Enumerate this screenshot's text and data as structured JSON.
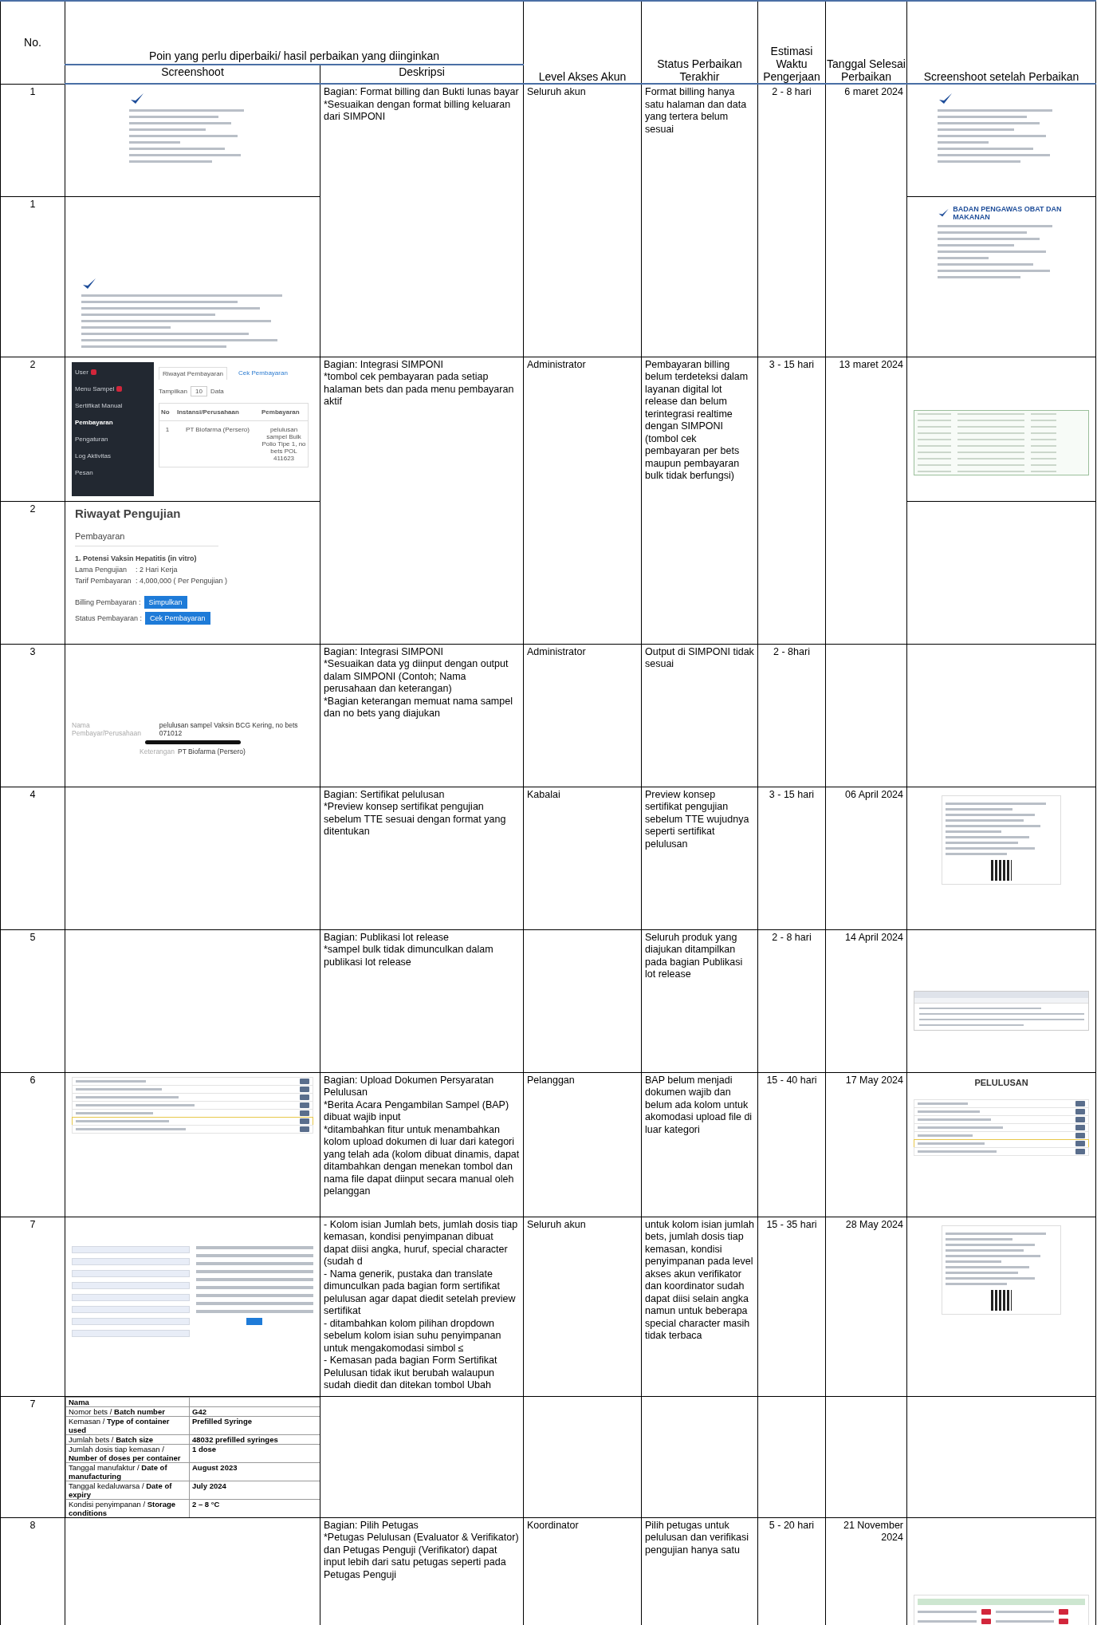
{
  "header": {
    "no": "No.",
    "group": "Poin yang perlu diperbaiki/ hasil perbaikan yang diinginkan",
    "screenshot": "Screenshoot",
    "description": "Deskripsi",
    "level": "Level Akses Akun",
    "status": "Status Perbaikan Terakhir",
    "estimate": "Estimasi Waktu Pengerjaan",
    "date": "Tanggal Selesai Perbaikan",
    "after": "Screenshoot setelah Perbaikan"
  },
  "items": [
    {
      "description": "Bagian: Format billing dan Bukti lunas bayar\n*Sesuaikan dengan format billing keluaran dari SIMPONI",
      "level": "Seluruh akun",
      "status": "Format billing hanya satu halaman dan data yang tertera belum sesuai",
      "estimate": "2 - 8 hari",
      "date": "6 maret 2024",
      "parts": [
        {
          "no": "1",
          "screenshot": {
            "kind": "doc"
          },
          "after": {
            "kind": "doc"
          }
        },
        {
          "no": "1",
          "screenshot": {
            "kind": "doc-wide"
          },
          "after": {
            "kind": "doc",
            "title": "BADAN PENGAWAS OBAT DAN MAKANAN"
          }
        }
      ]
    },
    {
      "description": "Bagian: Integrasi SIMPONI\n*tombol cek pembayaran pada setiap halaman bets dan pada menu pembayaran aktif",
      "level": "Administrator",
      "status": "Pembayaran billing belum terdeteksi dalam layanan digital lot release dan belum terintegrasi realtime dengan SIMPONI (tombol cek pembayaran per bets maupun pembayaran bulk tidak berfungsi)",
      "estimate": "3 - 15 hari",
      "date": "13 maret 2024",
      "parts": [
        {
          "no": "2",
          "screenshot": {
            "kind": "admin",
            "menu": [
              {
                "label": "User",
                "badge": true,
                "selected": false
              },
              {
                "label": "Menu Sampel",
                "badge": true,
                "selected": false
              },
              {
                "label": "Sertifikat Manual",
                "badge": false,
                "selected": false
              },
              {
                "label": "Pembayaran",
                "badge": false,
                "selected": true
              },
              {
                "label": "Pengaturan",
                "badge": false,
                "selected": false
              },
              {
                "label": "Log Aktivitas",
                "badge": false,
                "selected": false
              },
              {
                "label": "Pesan",
                "badge": false,
                "selected": false
              }
            ],
            "tabs": [
              {
                "label": "Riwayat Pembayaran",
                "selected": true
              },
              {
                "label": "Cek Pembayaran",
                "selected": false
              }
            ],
            "show_label": "Tampilkan",
            "show_value": "10",
            "show_unit": "Data",
            "columns": [
              "No",
              "Instansi/Perusahaan",
              "Pembayaran"
            ],
            "row": [
              "1",
              "PT Biofarma (Persero)",
              "pelulusan sampel Bulk Polio Tipe 1, no bets POL 411623"
            ]
          },
          "after": {
            "kind": "sheet"
          }
        },
        {
          "no": "2",
          "screenshot": {
            "kind": "detail",
            "title": "Riwayat Pengujian",
            "section": "Pembayaran",
            "test": "1. Potensi Vaksin Hepatitis (in vitro)",
            "fields": [
              {
                "label": "Lama Pengujian",
                "value": ": 2 Hari Kerja"
              },
              {
                "label": "Tarif Pembayaran",
                "value": ": 4,000,000 ( Per Pengujian )"
              }
            ],
            "actions": [
              {
                "label": "Billing Pembayaran :",
                "button": "Simpulkan"
              },
              {
                "label": "Status Pembayaran :",
                "button": "Cek Pembayaran"
              }
            ]
          }
        }
      ]
    },
    {
      "description": "Bagian: Integrasi SIMPONI\n*Sesuaikan data yg diinput dengan output dalam SIMPONI (Contoh; Nama perusahaan dan keterangan)\n*Bagian keterangan memuat nama sampel dan no bets yang diajukan",
      "level": "Administrator",
      "status": "Output di SIMPONI tidak sesuai",
      "estimate": "2 - 8hari",
      "parts": [
        {
          "no": "3",
          "screenshot": {
            "kind": "output",
            "fields": [
              {
                "label": "Nama Pembayar/Perusahaan",
                "value": "pelulusan sampel Vaksin BCG Kering, no bets 071012"
              },
              {
                "label": "Keterangan",
                "value": "PT Biofarma (Persero)"
              }
            ]
          }
        }
      ]
    },
    {
      "description": "Bagian: Sertifikat pelulusan\n*Preview konsep sertifikat pengujian sebelum TTE sesuai dengan format yang ditentukan",
      "level": "Kabalai",
      "status": "Preview konsep sertifikat pengujian sebelum TTE wujudnya seperti sertifikat pelulusan",
      "estimate": "3 - 15 hari",
      "date": "06 April 2024",
      "parts": [
        {
          "no": "4",
          "after": {
            "kind": "cert"
          }
        }
      ]
    },
    {
      "description": "Bagian: Publikasi lot release\n*sampel bulk tidak dimunculkan dalam publikasi lot release",
      "status": "Seluruh produk yang diajukan ditampilkan pada bagian Publikasi lot release",
      "estimate": "2 - 8 hari",
      "date": "14 April 2024",
      "parts": [
        {
          "no": "5",
          "after": {
            "kind": "web"
          }
        }
      ]
    },
    {
      "description": "Bagian: Upload Dokumen Persyaratan Pelulusan\n*Berita Acara Pengambilan Sampel (BAP) dibuat wajib input\n*ditambahkan fitur untuk menambahkan kolom upload dokumen di luar dari kategori yang telah ada (kolom dibuat dinamis, dapat ditambahkan dengan menekan tombol dan nama file dapat diinput secara manual oleh pelanggan",
      "level": "Pelanggan",
      "status": "BAP belum menjadi dokumen wajib dan belum ada kolom untuk akomodasi upload file di luar kategori",
      "estimate": "15 - 40 hari",
      "date": "17 May 2024",
      "parts": [
        {
          "no": "6",
          "screenshot": {
            "kind": "list"
          },
          "after": {
            "kind": "list",
            "title": "PELULUSAN"
          }
        }
      ]
    },
    {
      "description": "- Kolom isian Jumlah bets, jumlah dosis tiap kemasan, kondisi penyimpanan dibuat dapat diisi angka, huruf, special character (sudah d\n- Nama generik, pustaka dan translate dimunculkan pada bagian form sertifikat pelulusan agar dapat diedit setelah preview sertifikat\n- ditambahkan kolom pilihan dropdown sebelum kolom isian suhu penyimpanan untuk mengakomodasi simbol ≤\n- Kemasan pada bagian Form Sertifikat Pelulusan tidak ikut berubah walaupun sudah diedit dan ditekan tombol Ubah",
      "level": "Seluruh akun",
      "status": "untuk kolom isian jumlah bets, jumlah dosis tiap kemasan, kondisi penyimpanan pada level akses akun verifikator dan koordinator sudah dapat diisi selain angka namun untuk beberapa special character masih tidak terbaca",
      "estimate": "15 - 35 hari",
      "date": "28 May 2024",
      "parts": [
        {
          "no": "7",
          "screenshot": {
            "kind": "form"
          },
          "after": {
            "kind": "cert"
          }
        }
      ]
    },
    {
      "parts": [
        {
          "no": "7",
          "screenshot": {
            "kind": "spec",
            "rows": [
              {
                "label": "**Nama**"
              },
              {
                "label": "Nomor bets / **Batch number**",
                "value": "G42"
              },
              {
                "label": "Kemasan / **Type of container used**",
                "value": "Prefilled Syringe"
              },
              {
                "label": "Jumlah bets / **Batch size**",
                "value": "48032 prefilled syringes"
              },
              {
                "label": "Jumlah dosis tiap kemasan / **Number of doses per container**",
                "value": "1 dose"
              },
              {
                "label": "Tanggal manufaktur / **Date of manufacturing**",
                "value": "August 2023"
              },
              {
                "label": "Tanggal kedaluwarsa / **Date of expiry**",
                "value": "July 2024"
              },
              {
                "label": "Kondisi penyimpanan / **Storage conditions**",
                "value": "2 – 8 °C"
              }
            ]
          }
        }
      ]
    },
    {
      "description": "Bagian: Pilih Petugas\n*Petugas Pelulusan (Evaluator & Verifikator) dan Petugas Penguji (Verifikator) dapat input lebih dari satu petugas seperti pada Petugas Penguji",
      "level": "Koordinator",
      "status": "Pilih petugas untuk pelulusan dan verifikasi pengujian hanya satu",
      "estimate": "5 - 20 hari",
      "date": "21 November 2024",
      "parts": [
        {
          "no": "8",
          "after": {
            "kind": "picker"
          }
        }
      ]
    }
  ]
}
